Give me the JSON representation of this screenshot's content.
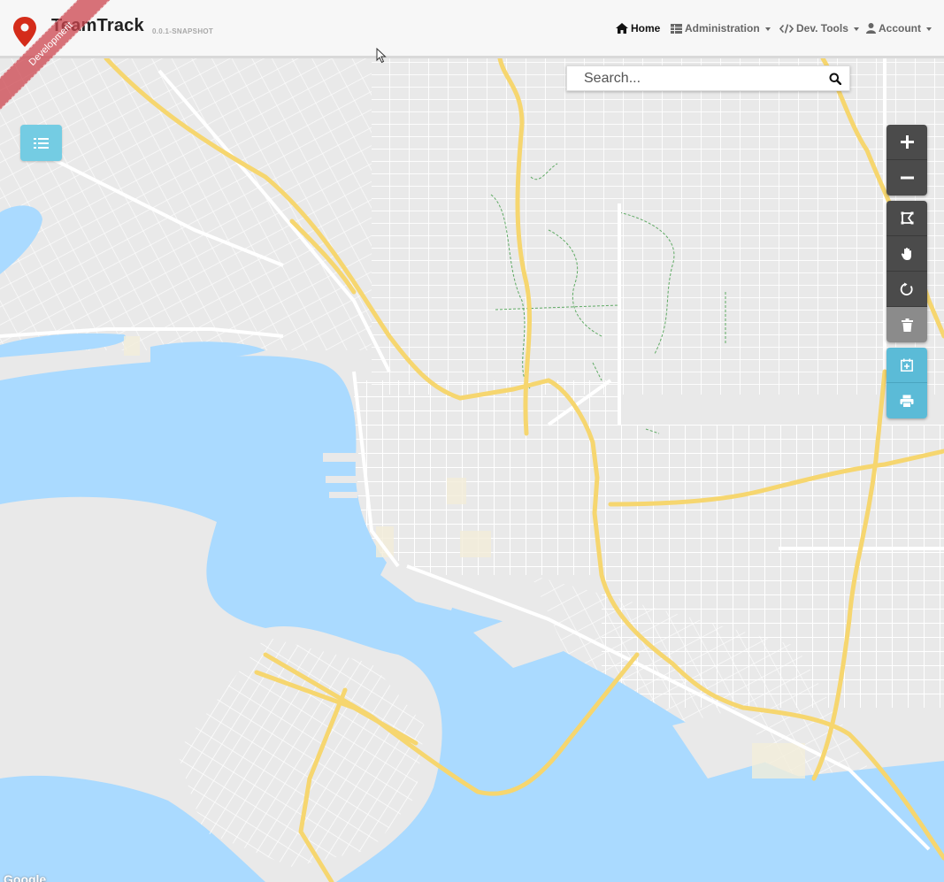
{
  "app": {
    "brand": "TeamTrack",
    "version": "0.0.1-SNAPSHOT",
    "ribbon": "Development"
  },
  "nav": {
    "home": "Home",
    "administration": "Administration",
    "dev_tools": "Dev. Tools",
    "account": "Account"
  },
  "search": {
    "placeholder": "Search...",
    "value": ""
  },
  "map": {
    "attribution": "Google"
  },
  "colors": {
    "water": "#aadaff",
    "land": "#e9e9e9",
    "highway": "#f6d66f",
    "road": "#ffffff",
    "park": "#5faa64",
    "info_button": "#74cce3",
    "toolbar_dark": "#4b4b4b"
  },
  "toolbar": {
    "icons": [
      "zoom-in-icon",
      "zoom-out-icon",
      "draw-polygon-icon",
      "pan-hand-icon",
      "refresh-circle-icon",
      "trash-icon",
      "calendar-add-icon",
      "print-icon"
    ]
  }
}
